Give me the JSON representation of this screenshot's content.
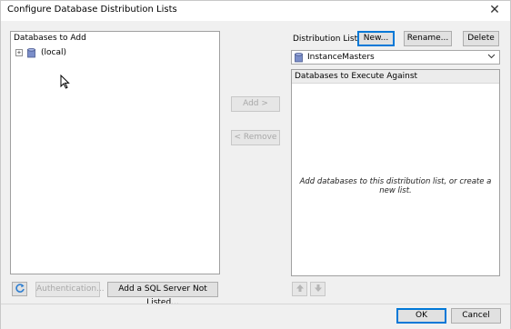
{
  "window": {
    "title": "Configure Database Distribution Lists",
    "close_glyph": "✕"
  },
  "left": {
    "header": "Databases to Add",
    "tree": [
      {
        "label": "(local)",
        "expander": "+"
      }
    ]
  },
  "middle": {
    "add_label": "Add >",
    "remove_label": "< Remove"
  },
  "right": {
    "distribution_list_label": "Distribution List:",
    "new_label": "New...",
    "rename_label": "Rename...",
    "delete_label": "Delete",
    "selected_list": "InstanceMasters",
    "panel_header": "Databases to Execute Against",
    "empty_message": "Add databases to this distribution list, or create a new list."
  },
  "bottom_left": {
    "authentication_label": "Authentication...",
    "add_server_label": "Add a SQL Server Not Listed..."
  },
  "footer": {
    "ok_label": "OK",
    "cancel_label": "Cancel"
  },
  "icons": {
    "refresh": "refresh-icon",
    "move_up": "arrow-up-icon",
    "move_down": "arrow-down-icon",
    "database": "database-icon"
  },
  "colors": {
    "accent": "#0078d7",
    "db_icon": "#6a7db8"
  }
}
